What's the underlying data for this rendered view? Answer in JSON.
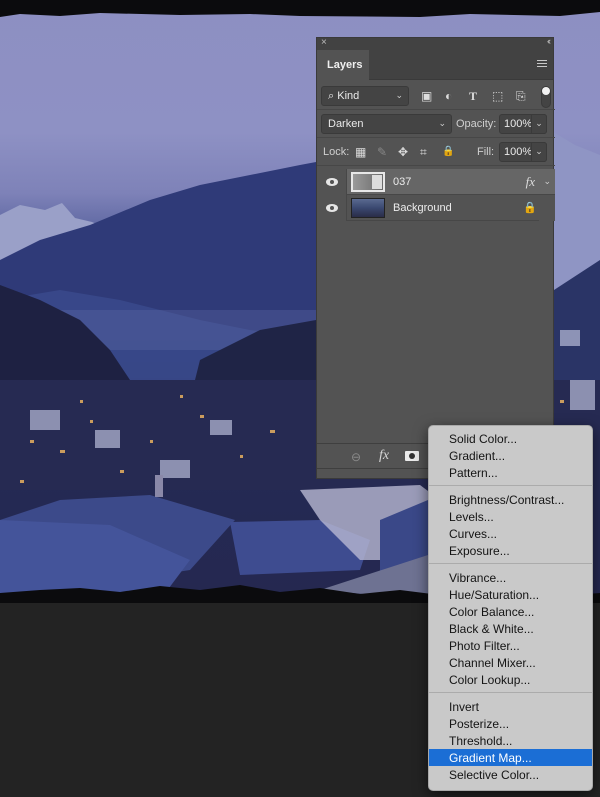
{
  "canvas": {
    "description": "Night mountain village photo with blue tint"
  },
  "layers_panel": {
    "close_glyph": "×",
    "collapse_glyph": "‹‹",
    "tab_label": "Layers",
    "filter": {
      "label": "Kind",
      "search_glyph": "⌕"
    },
    "filter_icons": [
      "image-filter-icon",
      "adjustment-filter-icon",
      "type-filter-icon",
      "shape-filter-icon",
      "smart-object-filter-icon"
    ],
    "filter_icon_glyphs": [
      "▣",
      "◐",
      "T",
      "⬚",
      "⎘"
    ],
    "blend_mode": "Darken",
    "opacity_label": "Opacity:",
    "opacity_value": "100%",
    "lock_label": "Lock:",
    "lock_glyphs": [
      "▦",
      "✎",
      "✥",
      "⌗",
      "🔒"
    ],
    "fill_label": "Fill:",
    "fill_value": "100%",
    "layers": [
      {
        "name": "037",
        "fx": "fx",
        "selected": true
      },
      {
        "name": "Background",
        "locked": true
      }
    ],
    "footer": {
      "link_glyph": "⊖",
      "fx_glyph": "fx"
    }
  },
  "context_menu": {
    "groups": [
      [
        "Solid Color...",
        "Gradient...",
        "Pattern..."
      ],
      [
        "Brightness/Contrast...",
        "Levels...",
        "Curves...",
        "Exposure..."
      ],
      [
        "Vibrance...",
        "Hue/Saturation...",
        "Color Balance...",
        "Black & White...",
        "Photo Filter...",
        "Channel Mixer...",
        "Color Lookup..."
      ],
      [
        "Invert",
        "Posterize...",
        "Threshold...",
        "Gradient Map...",
        "Selective Color..."
      ]
    ],
    "highlighted": "Gradient Map...",
    "highlight_color": "#1b6ed5"
  }
}
